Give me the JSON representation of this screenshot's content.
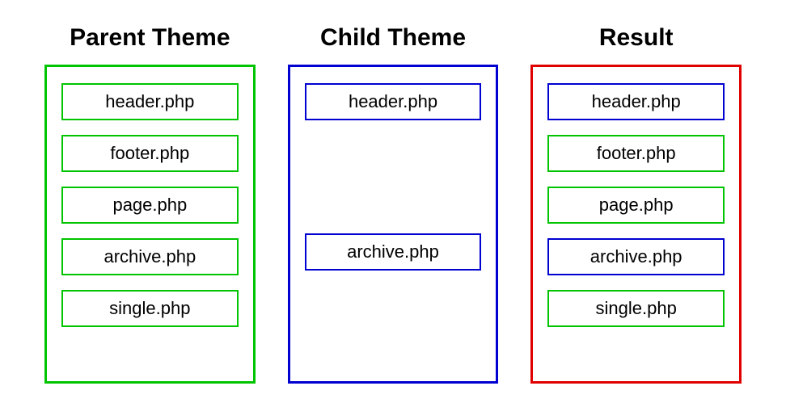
{
  "columns": {
    "parent": {
      "title": "Parent Theme",
      "boxColor": "green-border",
      "files": [
        {
          "label": "header.php",
          "color": "green-border"
        },
        {
          "label": "footer.php",
          "color": "green-border"
        },
        {
          "label": "page.php",
          "color": "green-border"
        },
        {
          "label": "archive.php",
          "color": "green-border"
        },
        {
          "label": "single.php",
          "color": "green-border"
        }
      ]
    },
    "child": {
      "title": "Child Theme",
      "boxColor": "blue-border",
      "files": [
        {
          "label": "header.php",
          "color": "blue-border"
        },
        {
          "spacer": true
        },
        {
          "spacer": true
        },
        {
          "label": "archive.php",
          "color": "blue-border"
        }
      ]
    },
    "result": {
      "title": "Result",
      "boxColor": "red-border",
      "files": [
        {
          "label": "header.php",
          "color": "blue-border"
        },
        {
          "label": "footer.php",
          "color": "green-border"
        },
        {
          "label": "page.php",
          "color": "green-border"
        },
        {
          "label": "archive.php",
          "color": "blue-border"
        },
        {
          "label": "single.php",
          "color": "green-border"
        }
      ]
    }
  }
}
